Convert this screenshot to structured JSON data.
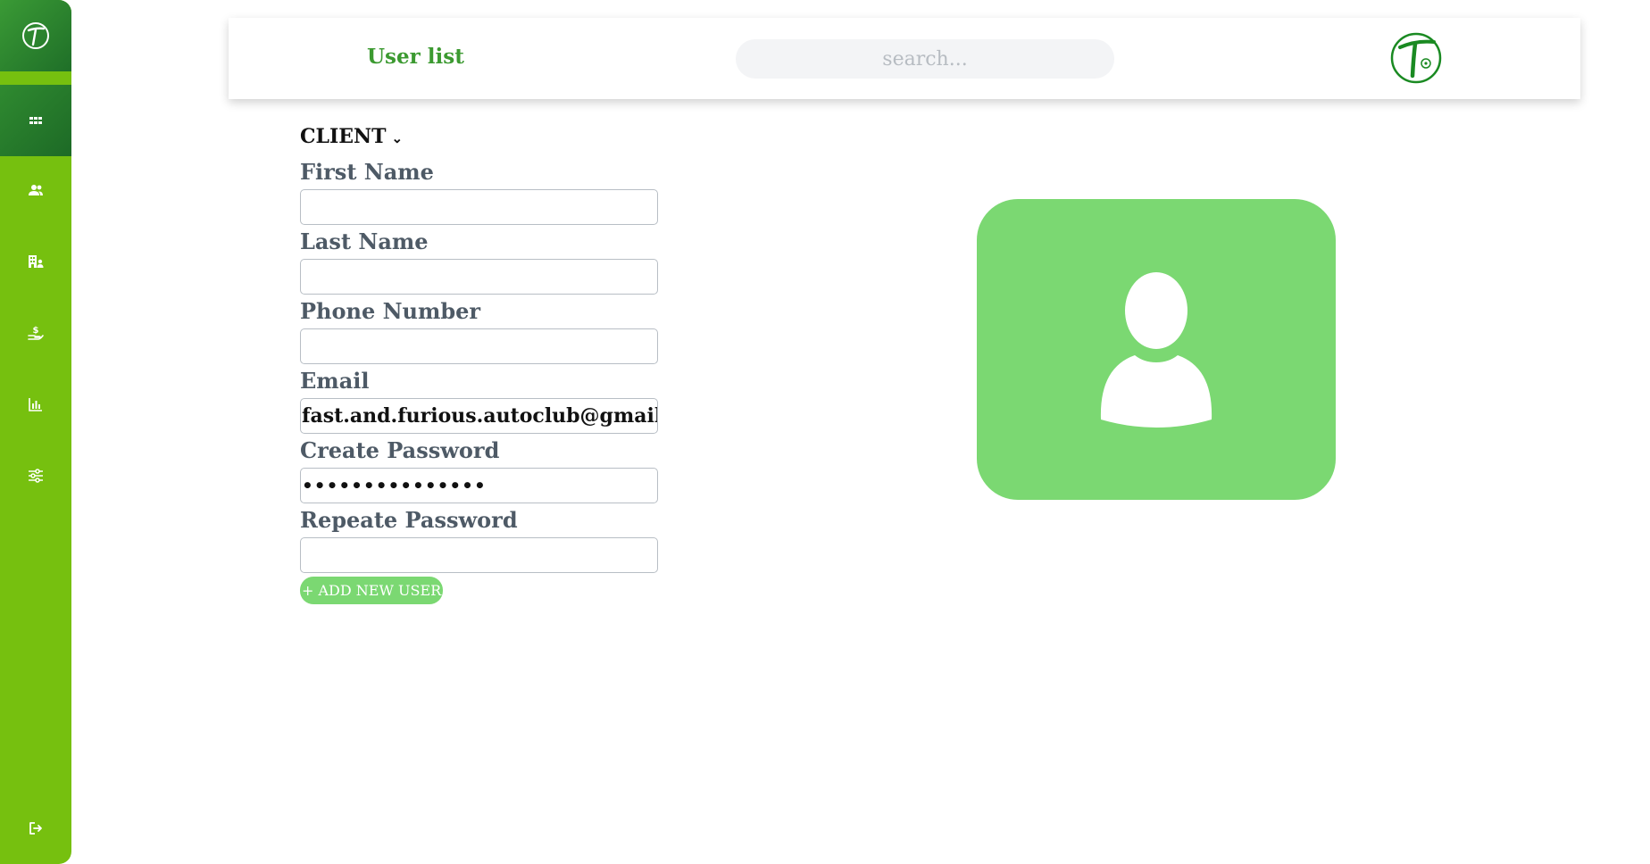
{
  "sidebar": {
    "logo_icon": "brand-logo-icon",
    "items": [
      {
        "name": "dashboard",
        "icon": "grid-icon"
      },
      {
        "name": "users",
        "icon": "users-icon"
      },
      {
        "name": "companies",
        "icon": "building-user-icon"
      },
      {
        "name": "payments",
        "icon": "hand-dollar-icon"
      },
      {
        "name": "reports",
        "icon": "bar-chart-icon"
      },
      {
        "name": "settings",
        "icon": "sliders-icon"
      },
      {
        "name": "logout",
        "icon": "logout-icon"
      }
    ]
  },
  "header": {
    "title": "User list",
    "search_placeholder": "search...",
    "search_value": ""
  },
  "form": {
    "role": "CLIENT",
    "fields": [
      {
        "label": "First Name",
        "value": ""
      },
      {
        "label": "Last Name",
        "value": ""
      },
      {
        "label": "Phone Number",
        "value": ""
      },
      {
        "label": "Email",
        "value": "fast.and.furious.autoclub@gmail.co"
      },
      {
        "label": "Create Password",
        "value": "•••••••••••••••"
      },
      {
        "label": "Repeate Password",
        "value": ""
      }
    ],
    "submit_label": "+ ADD NEW USER"
  },
  "avatar": {
    "icon": "user-silhouette-icon"
  },
  "colors": {
    "sidebar": "#76c00f",
    "sidebar_active": "#2a7f2d",
    "accent_green": "#3c9a31",
    "light_green": "#7bd872",
    "label_gray": "#4e5a66"
  }
}
